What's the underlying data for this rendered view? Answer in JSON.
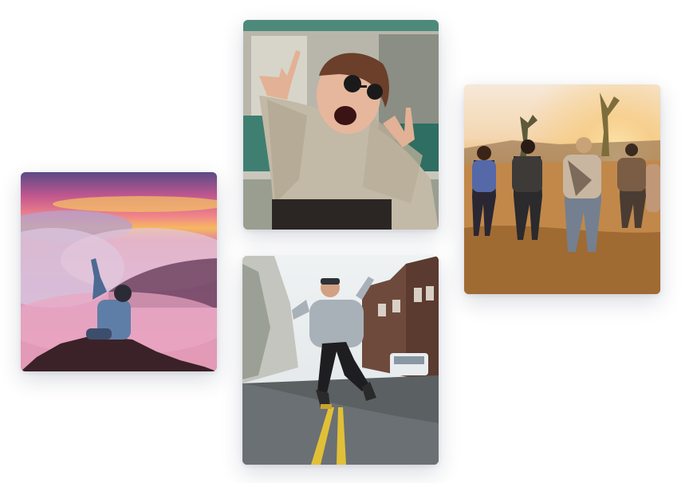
{
  "gallery": {
    "photos": [
      {
        "id": "clouds",
        "subject": "person-on-mountain-above-clouds-photo"
      },
      {
        "id": "girl",
        "subject": "woman-with-sunglasses-peace-sign-photo"
      },
      {
        "id": "street",
        "subject": "man-jumping-on-street-photo"
      },
      {
        "id": "desert",
        "subject": "friends-running-desert-sunset-photo"
      }
    ]
  }
}
